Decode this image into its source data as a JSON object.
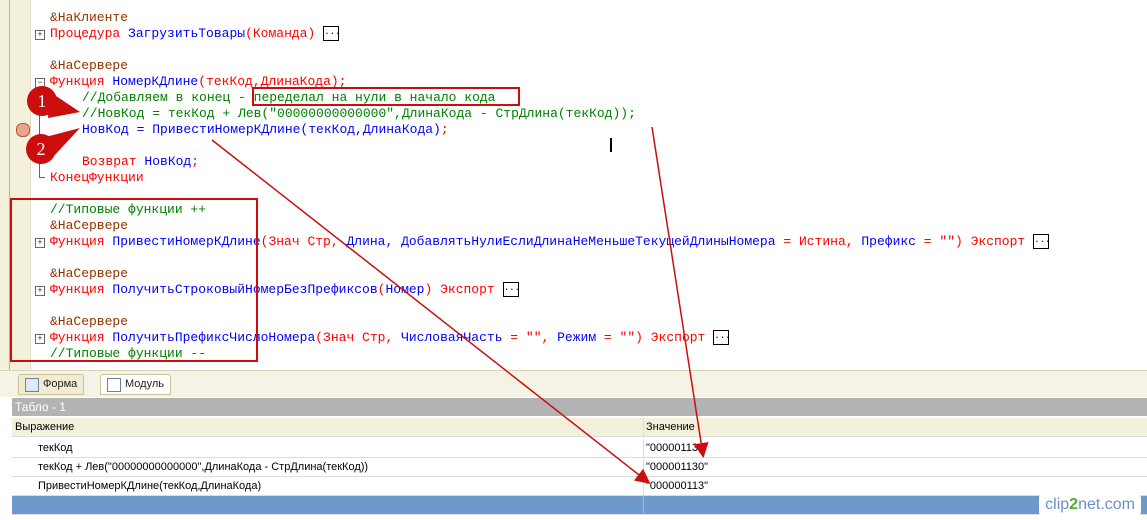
{
  "editor": {
    "l1": "&НаКлиенте",
    "l2_kw": "Процедура",
    "l2_id": "ЗагрузитьТовары",
    "l2_p": "(Команда)",
    "l3": "&НаСервере",
    "l4_kw": "Функция",
    "l4_id": "НомерКДлине",
    "l4_p": "(текКод,ДлинаКода);",
    "l5a": "//Добавляем в конец - ",
    "l5b": "переделал на нули в начало кода",
    "l6": "//НовКод = текКод + Лев(\"00000000000000\",ДлинаКода - СтрДлина(текКод));",
    "l7_a": "НовКод = ПривестиНомерКДлине(текКод,ДлинаКода)",
    "l7_b": ";",
    "l8_kw": "Возврат",
    "l8_id": " НовКод",
    "l8_e": ";",
    "l9": "КонецФункции",
    "l10": "//Типовые функции ++",
    "l11": "&НаСервере",
    "l12_kw": "Функция",
    "l12_id": " ПривестиНомерКДлине",
    "l12_a": "(Знач Стр, ",
    "l12_b": "Длина, ДобавлятьНулиЕслиДлинаНеМеньшеТекущейДлиныНомера",
    "l12_c": " = Истина, ",
    "l12_d": "Префикс",
    "l12_e": " = \"\") Экспорт",
    "l13": "&НаСервере",
    "l14_kw": "Функция",
    "l14_id": " ПолучитьСтроковыйНомерБезПрефиксов",
    "l14_a": "(",
    "l14_b": "Номер",
    "l14_c": ") Экспорт",
    "l15": "&НаСервере",
    "l16_kw": "Функция",
    "l16_id": " ПолучитьПрефиксЧислоНомера",
    "l16_a": "(Знач Стр, ",
    "l16_b": "ЧисловаяЧасть",
    "l16_c": " = \"\", ",
    "l16_d": "Режим",
    "l16_e": " = \"\") Экспорт",
    "l17": "//Типовые функции --",
    "dots": "..."
  },
  "tabs": [
    {
      "label": "Форма",
      "icon": "form-icon"
    },
    {
      "label": "Модуль",
      "icon": "module-icon"
    }
  ],
  "panel": {
    "title": "Табло - 1",
    "columns": [
      "Выражение",
      "Значение"
    ],
    "rows": [
      [
        "текКод",
        "\"00000113\""
      ],
      [
        "текКод + Лев(\"00000000000000\",ДлинаКода - СтрДлина(текКод))",
        "\"000001130\""
      ],
      [
        "ПривестиНомерКДлине(текКод,ДлинаКода)",
        "\"000000113\""
      ]
    ]
  },
  "annotations": {
    "badge1": "1",
    "badge2": "2",
    "color": "#cc0d0d"
  },
  "watermark": {
    "a": "clip",
    "b": "2",
    "c": "net.com"
  }
}
